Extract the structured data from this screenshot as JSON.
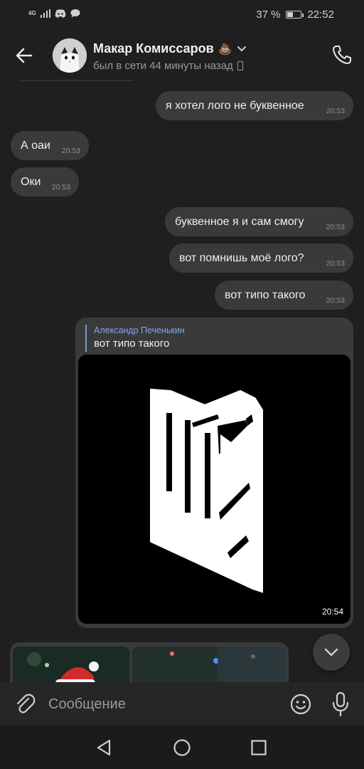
{
  "status_bar": {
    "network": "4G",
    "battery_percent": "37 %",
    "battery_level": 0.37,
    "time": "22:52"
  },
  "header": {
    "contact_name": "Макар Комиссаров",
    "name_emoji": "💩",
    "last_seen": "был в сети 44 минуты назад"
  },
  "messages": [
    {
      "direction": "out",
      "text": "я хотел лого не буквенное",
      "time": "20:53"
    },
    {
      "direction": "in",
      "text": "А оаи",
      "time": "20:53"
    },
    {
      "direction": "in",
      "text": "Оки",
      "time": "20:53"
    },
    {
      "direction": "out",
      "text": "буквенное я и сам смогу",
      "time": "20:53"
    },
    {
      "direction": "out",
      "text": "вот помнишь моё лого?",
      "time": "20:53"
    },
    {
      "direction": "out",
      "text": "вот типо такого",
      "time": "20:53"
    }
  ],
  "reply_media": {
    "reply_author": "Александр Печенькин",
    "reply_text": "вот типо такого",
    "time": "20:54"
  },
  "composer": {
    "placeholder": "Сообщение"
  },
  "icons": {
    "back": "arrow-left-icon",
    "call": "phone-icon",
    "attach": "paperclip-icon",
    "emoji": "smiley-icon",
    "mic": "microphone-icon",
    "scroll": "chevron-down-icon",
    "nav_back": "triangle-back-icon",
    "nav_home": "circle-home-icon",
    "nav_recent": "square-recent-icon"
  },
  "colors": {
    "background": "#1f1f1f",
    "bubble": "#3a3a3a",
    "accent": "#7fa8e6"
  }
}
